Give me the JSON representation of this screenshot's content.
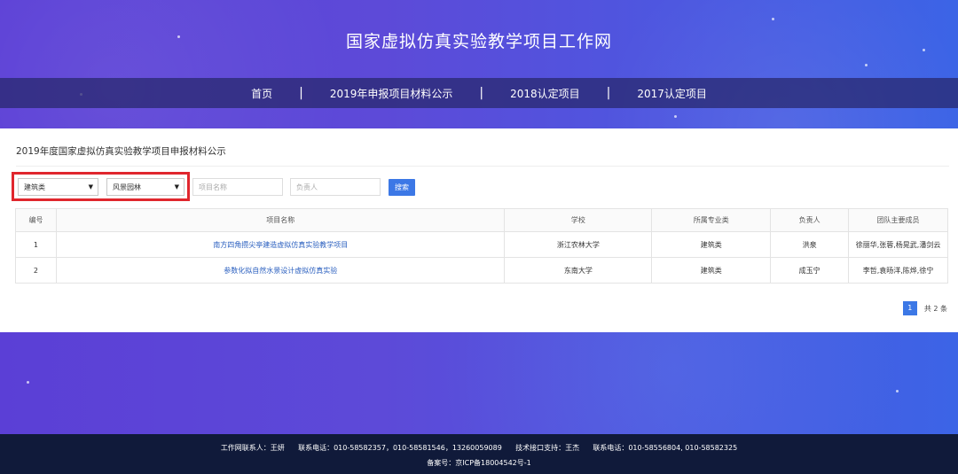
{
  "site": {
    "title": "国家虚拟仿真实验教学项目工作网"
  },
  "nav": {
    "items": [
      "首页",
      "2019年申报项目材料公示",
      "2018认定项目",
      "2017认定项目"
    ],
    "separator": "|"
  },
  "panel": {
    "title": "2019年度国家虚拟仿真实验教学项目申报材料公示",
    "filters": {
      "category_value": "建筑类",
      "subcategory_value": "风景园林",
      "project_placeholder": "项目名称",
      "leader_placeholder": "负责人",
      "search_label": "搜索"
    },
    "table": {
      "headers": [
        "编号",
        "项目名称",
        "学校",
        "所属专业类",
        "负责人",
        "团队主要成员"
      ],
      "rows": [
        [
          "1",
          "南方四角攒尖亭建造虚拟仿真实验教学项目",
          "浙江农林大学",
          "建筑类",
          "洪泉",
          "徐丽华,张蓉,杨晃武,潘剑云"
        ],
        [
          "2",
          "参数化拟自然水景设计虚拟仿真实验",
          "东南大学",
          "建筑类",
          "成玉宁",
          "李哲,袁旸洋,陈烨,徐宁"
        ]
      ]
    },
    "pager": {
      "current": "1",
      "total_text": "共 2 条"
    }
  },
  "footer": {
    "line1": "工作网联系人：王妍      联系电话：010-58582357，010-58581546，13260059089      技术接口支持：王杰      联系电话：010-58556804, 010-58582325",
    "line2": "备案号：京ICP备18004542号-1"
  },
  "colors": {
    "accent": "#3c78e6",
    "highlight": "#e0262d",
    "footer_bg": "#101a3a"
  }
}
